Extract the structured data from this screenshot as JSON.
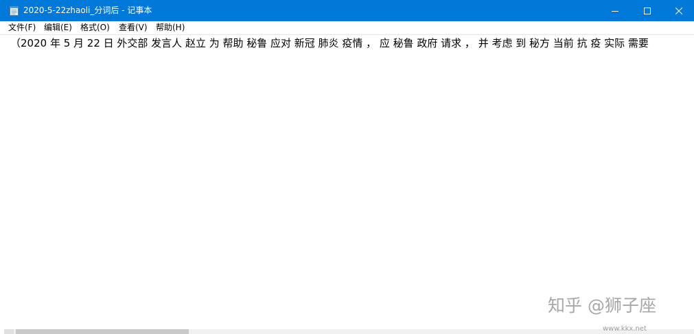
{
  "window": {
    "title": "2020-5-22zhaoli_分词后 - 记事本",
    "accent_color": "#0078d7",
    "icons": {
      "app": "notepad-icon",
      "minimize": "minimize-icon",
      "maximize": "maximize-icon",
      "close": "close-icon"
    }
  },
  "menu": {
    "items": [
      {
        "label": "文件(F)"
      },
      {
        "label": "编辑(E)"
      },
      {
        "label": "格式(O)"
      },
      {
        "label": "查看(V)"
      },
      {
        "label": "帮助(H)"
      }
    ]
  },
  "editor": {
    "text": "（2020 年 5 月 22 日 外交部 发言人 赵立 为 帮助 秘鲁 应对 新冠 肺炎 疫情 ， 应 秘鲁 政府 请求 ， 并 考虑 到 秘方 当前 抗 疫 实际 需要"
  },
  "watermark": {
    "text": "知乎 @狮子座",
    "site": "www.kkx.net"
  }
}
